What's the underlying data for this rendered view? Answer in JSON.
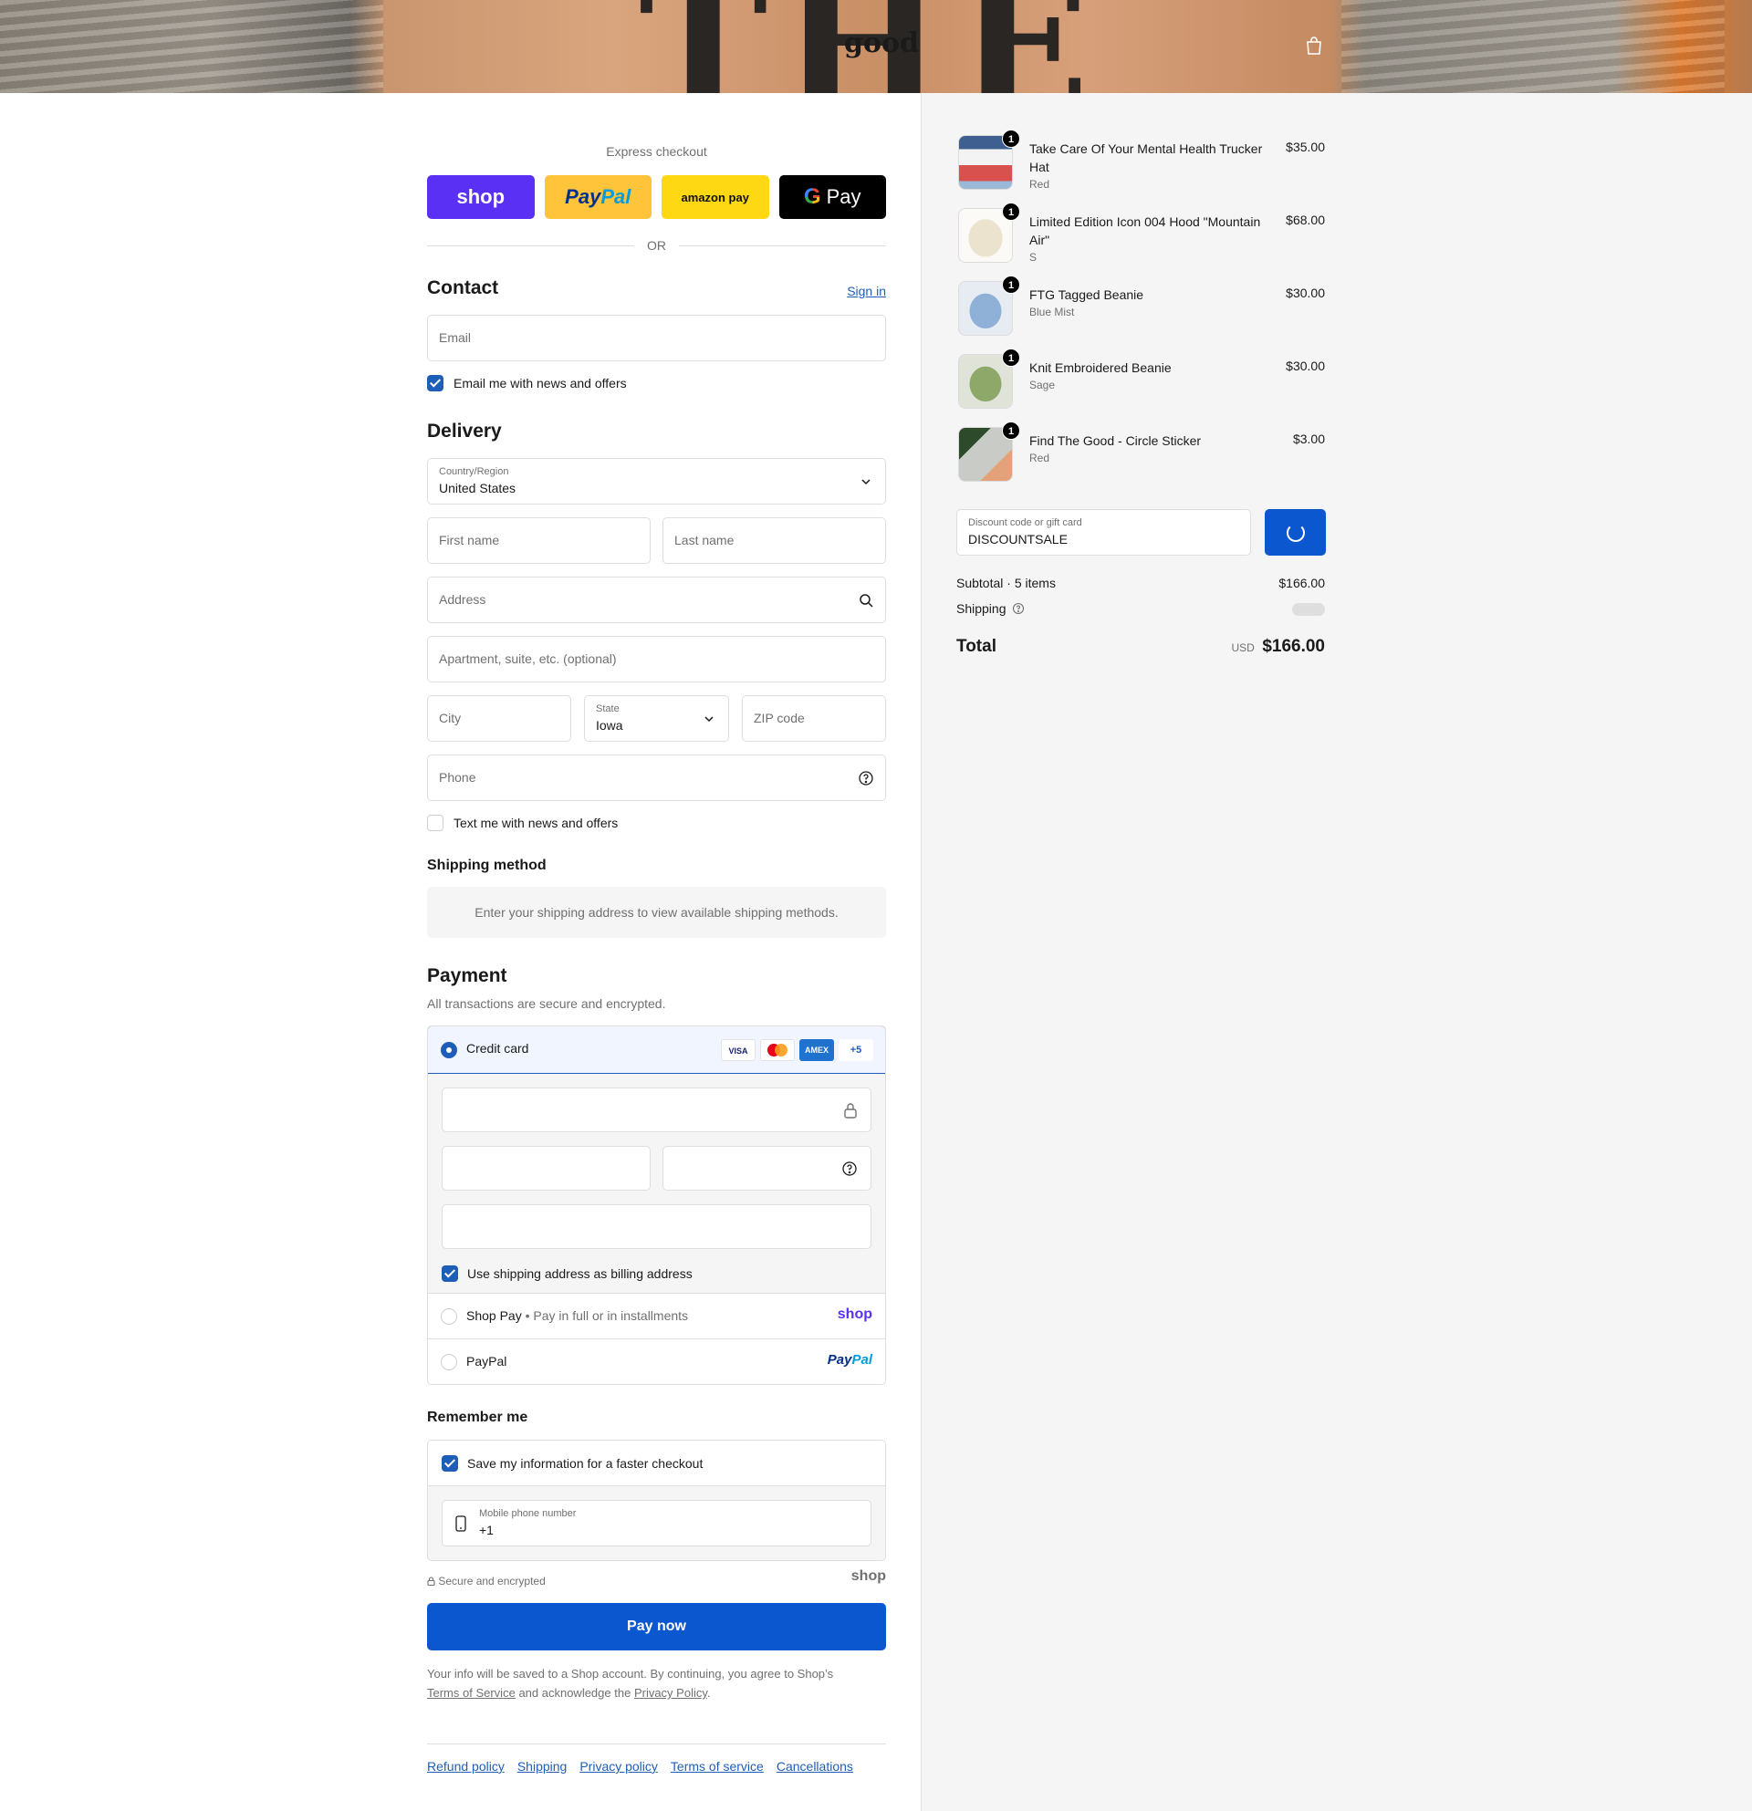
{
  "header": {
    "logo_text": "good",
    "cart_icon": "bag-icon"
  },
  "express": {
    "label": "Express checkout",
    "shop_label": "shop",
    "paypal_label_1": "Pay",
    "paypal_label_2": "Pal",
    "amazon_label": "amazon pay",
    "gpay_g": "G",
    "gpay_label": "Pay",
    "or_label": "OR"
  },
  "contact": {
    "title": "Contact",
    "sign_in": "Sign in",
    "email_placeholder": "Email",
    "news_label": "Email me with news and offers",
    "news_checked": true
  },
  "delivery": {
    "title": "Delivery",
    "country_label": "Country/Region",
    "country_value": "United States",
    "first_name_placeholder": "First name",
    "last_name_placeholder": "Last name",
    "address_placeholder": "Address",
    "apartment_placeholder": "Apartment, suite, etc. (optional)",
    "city_placeholder": "City",
    "state_label": "State",
    "state_value": "Iowa",
    "zip_placeholder": "ZIP code",
    "phone_placeholder": "Phone",
    "text_label": "Text me with news and offers",
    "text_checked": false
  },
  "shipping_method": {
    "title": "Shipping method",
    "message": "Enter your shipping address to view available shipping methods."
  },
  "payment": {
    "title": "Payment",
    "subtitle": "All transactions are secure and encrypted.",
    "credit_card_label": "Credit card",
    "cards": [
      "VISA",
      "MC",
      "AMEX",
      "+5"
    ],
    "billing_label": "Use shipping address as billing address",
    "billing_checked": true,
    "shop_pay_label": "Shop Pay",
    "shop_pay_sep": "•",
    "shop_pay_desc": "Pay in full or in installments",
    "shop_pay_logo": "shop",
    "paypal_label": "PayPal",
    "paypal_logo_1": "Pay",
    "paypal_logo_2": "Pal"
  },
  "remember": {
    "title": "Remember me",
    "save_label": "Save my information for a faster checkout",
    "save_checked": true,
    "phone_label": "Mobile phone number",
    "phone_value": "+1",
    "secure_label": "Secure and encrypted",
    "shop_logo": "shop"
  },
  "pay_now": "Pay now",
  "legal": {
    "text_1": "Your info will be saved to a Shop account. By continuing, you agree to Shop’s",
    "terms": "Terms of Service",
    "text_2": "and acknowledge the",
    "privacy": "Privacy Policy",
    "text_3": "."
  },
  "footer_links": [
    "Refund policy",
    "Shipping",
    "Privacy policy",
    "Terms of service",
    "Cancellations"
  ],
  "cart": {
    "items": [
      {
        "qty": "1",
        "name": "Take Care Of Your Mental Health Trucker Hat",
        "variant": "Red",
        "price": "$35.00"
      },
      {
        "qty": "1",
        "name": "Limited Edition Icon 004 Hood \"Mountain Air\"",
        "variant": "S",
        "price": "$68.00"
      },
      {
        "qty": "1",
        "name": "FTG Tagged Beanie",
        "variant": "Blue Mist",
        "price": "$30.00"
      },
      {
        "qty": "1",
        "name": "Knit Embroidered Beanie",
        "variant": "Sage",
        "price": "$30.00"
      },
      {
        "qty": "1",
        "name": "Find The Good - Circle Sticker",
        "variant": "Red",
        "price": "$3.00"
      }
    ],
    "discount_label": "Discount code or gift card",
    "discount_value": "DISCOUNTSALE",
    "subtotal_label": "Subtotal · 5 items",
    "subtotal_value": "$166.00",
    "shipping_label": "Shipping",
    "total_label": "Total",
    "currency": "USD",
    "total_value": "$166.00"
  }
}
